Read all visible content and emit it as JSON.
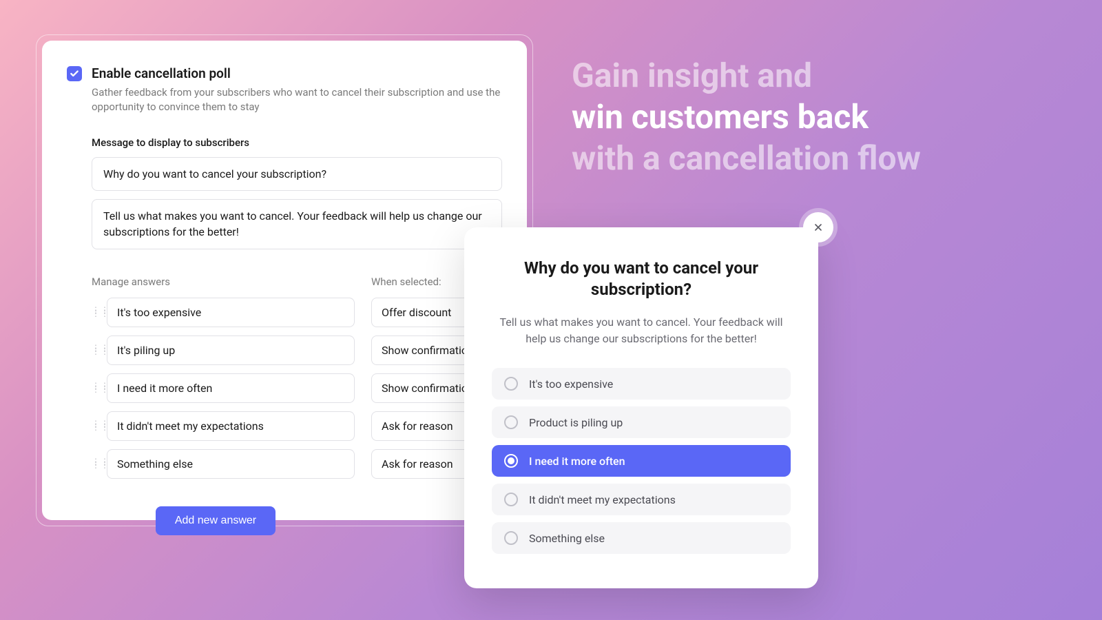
{
  "hero": {
    "line1": "Gain insight and",
    "line2_strong": "win customers back",
    "line3": "with a cancellation flow"
  },
  "settings": {
    "enable_label": "Enable cancellation poll",
    "enable_desc": "Gather feedback from your subscribers who want to cancel their subscription and use the opportunity to convince them to stay",
    "message_label": "Message to display to subscribers",
    "message_title": "Why do you want to cancel your subscription?",
    "message_body": "Tell us what makes you want to cancel. Your feedback will help us change our  subscriptions for the better!",
    "manage_header": "Manage answers",
    "when_header": "When selected:",
    "answers": [
      {
        "text": "It's too expensive",
        "action": "Offer discount"
      },
      {
        "text": "It's piling up",
        "action": "Show confirmation"
      },
      {
        "text": "I need it more often",
        "action": "Show confirmation"
      },
      {
        "text": "It didn't meet my expectations",
        "action": "Ask for reason"
      },
      {
        "text": "Something else",
        "action": "Ask for reason"
      }
    ],
    "add_button": "Add new answer"
  },
  "poll": {
    "title": "Why do you want to cancel your subscription?",
    "desc": "Tell us what makes you want to cancel. Your feedback will help us change our subscriptions for the better!",
    "options": [
      {
        "label": "It's too expensive",
        "selected": false
      },
      {
        "label": "Product is piling up",
        "selected": false
      },
      {
        "label": "I need it more often",
        "selected": true
      },
      {
        "label": "It didn't meet my expectations",
        "selected": false
      },
      {
        "label": "Something else",
        "selected": false
      }
    ]
  }
}
